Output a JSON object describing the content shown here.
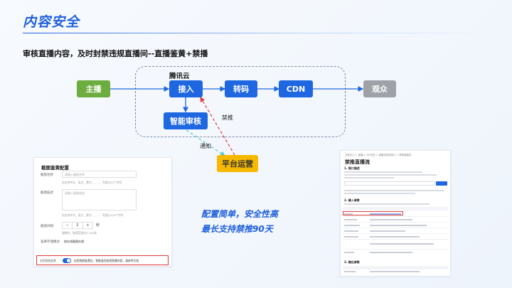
{
  "header": {
    "title": "内容安全",
    "subtitle": "审核直播内容，及时封禁违规直播间--直播鉴黄+禁播"
  },
  "flow": {
    "group_label": "腾讯云",
    "nodes": {
      "anchor": "主播",
      "ingest": "接入",
      "transcode": "转码",
      "cdn": "CDN",
      "audience": "观众",
      "smart_review": "智能审核",
      "platform_ops": "平台运营"
    },
    "edge_labels": {
      "notify": "通知",
      "ban": "禁推"
    },
    "colors": {
      "blue": "#1f67e0",
      "green": "#6dac3e",
      "gray": "#9ea2a8",
      "gold": "#f7b800",
      "red_dashed": "#e03b3b",
      "teal_dashed": "#5bc4d6"
    }
  },
  "slogan": {
    "line1": "配置简单，安全性高",
    "line2": "最长支持禁推90天"
  },
  "config_panel": {
    "heading": "截图鉴黄配置",
    "field1_label": "截图名称",
    "field1_placeholder": "请输入截图名称",
    "field1_hint": "仅支持中文、英文、数字、_、-，不超过50个字符",
    "field2_label": "截图描述",
    "field2_placeholder": "请输入截图描述",
    "field2_hint": "仅支持中文、英文、数字、_、-，不超过100个字符",
    "interval_label": "截图间隔",
    "interval_minus": "−",
    "interval_value": "2",
    "interval_plus": "+",
    "interval_unit": "秒",
    "interval_hint": "整数秒，取值范围为5-300秒",
    "mode_label": "鉴黄存储模式",
    "mode_value": "按在线截图存储",
    "toggle_label": "启用智能鉴黄",
    "toggle_text": "启用智能鉴黄后，智能鉴别违规直播内容，请参考文档"
  },
  "doc_panel": {
    "breadcrumb": "文档中心 > 直播 > API文档 > 直播流相关接口 > 禁推直播流",
    "title": "禁推直播流",
    "section1": "1. 接口描述",
    "section2": "2. 输入参数",
    "section3": "3. 输出参数"
  }
}
